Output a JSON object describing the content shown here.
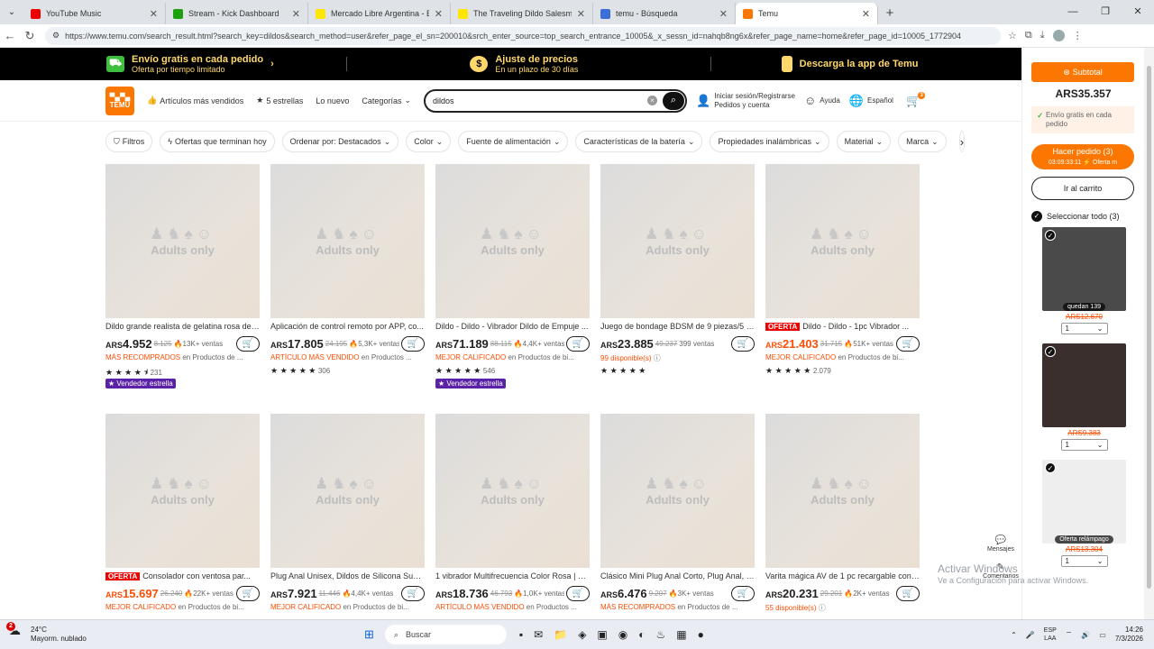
{
  "browser": {
    "tabs": [
      {
        "title": "YouTube Music",
        "color": "#e00"
      },
      {
        "title": "Stream - Kick Dashboard",
        "color": "#1ca00d"
      },
      {
        "title": "Mercado Libre Argentina - Envíos",
        "color": "#ffe600"
      },
      {
        "title": "The Traveling Dildo Salesman Doc",
        "color": "#ffe600"
      },
      {
        "title": "temu - Búsqueda",
        "color": "#3b6fd6"
      },
      {
        "title": "Temu",
        "color": "#fb7701"
      }
    ],
    "url": "https://www.temu.com/search_result.html?search_key=dildos&search_method=user&refer_page_el_sn=200010&srch_enter_source=top_search_entrance_10005&_x_sessn_id=nahqb8ng6x&refer_page_name=home&refer_page_id=10005_1772904"
  },
  "promo": [
    {
      "title": "Envío gratis en cada pedido",
      "sub": "Oferta por tiempo limitado",
      "icon": "truck-icon"
    },
    {
      "title": "Ajuste de precios",
      "sub": "En un plazo de 30 días",
      "icon": "price-adjust-icon"
    },
    {
      "title": "Descarga la app de Temu",
      "sub": "",
      "icon": "phone-icon"
    }
  ],
  "header": {
    "logo_top": "▀▄▀▄",
    "logo_text": "TEMU",
    "nav": [
      "Artículos más vendidos",
      "5 estrellas",
      "Lo nuevo",
      "Categorías"
    ],
    "search_value": "dildos",
    "account_line1": "Iniciar sesión/Registrarse",
    "account_line2": "Pedidos y cuenta",
    "help": "Ayuda",
    "lang": "Español",
    "cart_count": "3"
  },
  "filters": [
    "Filtros",
    "Ofertas que terminan hoy",
    "Ordenar por: Destacados",
    "Color",
    "Fuente de alimentación",
    "Características de la batería",
    "Propiedades inalámbricas",
    "Material",
    "Marca"
  ],
  "thumb_text": "Adults only",
  "products_row1": [
    {
      "badge": "",
      "title": "Dildo grande realista de gelatina rosa de ...",
      "price_cur": "ARS",
      "price": "4.952",
      "red": false,
      "old": "8.125",
      "sold": "🔥13K+ ventas",
      "tag": "MÁS RECOMPRADOS",
      "tag_rest": " en Productos de ...",
      "stars": "★ ★ ★ ★ ⯨",
      "reviews": "231",
      "vendor": "Vendedor estrella"
    },
    {
      "badge": "",
      "title": "Aplicación de control remoto por APP, co...",
      "price_cur": "ARS",
      "price": "17.805",
      "red": false,
      "old": "24.195",
      "sold": "🔥5,3K+ ventas",
      "tag": "ARTÍCULO MÁS VENDIDO",
      "tag_rest": " en Productos ...",
      "stars": "★ ★ ★ ★ ★",
      "reviews": "306",
      "vendor": ""
    },
    {
      "badge": "",
      "title": "Dildo - Dildo - Vibrador Dildo de Empuje ...",
      "price_cur": "ARS",
      "price": "71.189",
      "red": false,
      "old": "88.115",
      "sold": "🔥4,4K+ ventas",
      "tag": "MEJOR CALIFICADO",
      "tag_rest": " en Productos de bi...",
      "stars": "★ ★ ★ ★ ★",
      "reviews": "546",
      "vendor": "Vendedor estrella"
    },
    {
      "badge": "",
      "title": "Juego de bondage BDSM de 9 piezas/5 p...",
      "price_cur": "ARS",
      "price": "23.885",
      "red": false,
      "old": "49.237",
      "sold": "399 ventas",
      "tag": "99 disponible(s)",
      "tag_rest": " ⓘ",
      "stars": "★ ★ ★ ★ ★",
      "reviews": "",
      "vendor": ""
    },
    {
      "badge": "OFERTA",
      "title": "Dildo - Dildo - 1pc Vibrador ...",
      "price_cur": "ARS",
      "price": "21.403",
      "red": true,
      "old": "31.715",
      "sold": "🔥51K+ ventas",
      "tag": "MEJOR CALIFICADO",
      "tag_rest": " en Productos de bi...",
      "stars": "★ ★ ★ ★ ★",
      "reviews": "2.079",
      "vendor": ""
    }
  ],
  "products_row2": [
    {
      "badge": "OFERTA",
      "title": "Consolador con ventosa par...",
      "price_cur": "ARS",
      "price": "15.697",
      "red": true,
      "old": "26.240",
      "sold": "🔥22K+ ventas",
      "tag": "MEJOR CALIFICADO",
      "tag_rest": " en Productos de bi..."
    },
    {
      "badge": "",
      "title": "Plug Anal Unisex, Dildos de Silicona Suave...",
      "price_cur": "ARS",
      "price": "7.921",
      "red": false,
      "old": "11.446",
      "sold": "🔥4,4K+ ventas",
      "tag": "MEJOR CALIFICADO",
      "tag_rest": " en Productos de bi..."
    },
    {
      "badge": "",
      "title": "1 vibrador Multifrecuencia Color Rosa | E...",
      "price_cur": "ARS",
      "price": "18.736",
      "red": false,
      "old": "46.793",
      "sold": "🔥1,0K+ ventas",
      "tag": "ARTÍCULO MÁS VENDIDO",
      "tag_rest": " en Productos ..."
    },
    {
      "badge": "",
      "title": "Clásico Mini Plug Anal Corto, Plug Anal, Ba...",
      "price_cur": "ARS",
      "price": "6.476",
      "red": false,
      "old": "9.207",
      "sold": "🔥3K+ ventas",
      "tag": "MÁS RECOMPRADOS",
      "tag_rest": " en Productos de ..."
    },
    {
      "badge": "",
      "title": "Varita mágica AV de 1 pc recargable con ...",
      "price_cur": "ARS",
      "price": "20.231",
      "red": false,
      "old": "29.201",
      "sold": "🔥2K+ ventas",
      "tag": "55 disponible(s)",
      "tag_rest": " ⓘ"
    }
  ],
  "sidebar": {
    "subtotal_label": "Subtotal",
    "subtotal": "ARS35.357",
    "free_ship": "Envío gratis en cada pedido",
    "order_btn": "Hacer pedido (3)",
    "order_sub": "03:09:33:11  ⚡ Oferta m",
    "cart_btn": "Ir al carrito",
    "select_all": "Seleccionar todo (3)",
    "items": [
      {
        "label": "quedan 139",
        "price": "ARS12.670",
        "qty": "1",
        "bg": "#4a4a4a"
      },
      {
        "label": "",
        "price": "ARS9.383",
        "qty": "1",
        "bg": "#3a2f2c"
      },
      {
        "label": "Oferta relámpago",
        "price": "ARS13.304",
        "qty": "1",
        "bg": "#eeeeee"
      }
    ]
  },
  "floating": {
    "messages": "Mensajes",
    "comments": "Comentarios"
  },
  "watermark": {
    "line1": "Activar Windows",
    "line2": "Ve a Configuración para activar Windows."
  },
  "taskbar": {
    "temp": "24°C",
    "weather": "Mayorm. nublado",
    "weather_badge": "2",
    "search": "Buscar",
    "lang1": "ESP",
    "lang2": "LAA",
    "time": "14:26",
    "date": "7/3/2026"
  }
}
